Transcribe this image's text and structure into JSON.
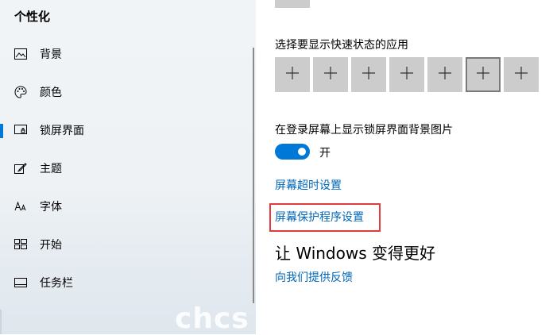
{
  "sidebar": {
    "title": "个性化",
    "items": [
      {
        "label": "背景",
        "icon": "image-icon"
      },
      {
        "label": "颜色",
        "icon": "palette-icon"
      },
      {
        "label": "锁屏界面",
        "icon": "lock-screen-icon",
        "active": true
      },
      {
        "label": "主题",
        "icon": "theme-brush-icon"
      },
      {
        "label": "字体",
        "icon": "font-icon"
      },
      {
        "label": "开始",
        "icon": "start-grid-icon"
      },
      {
        "label": "任务栏",
        "icon": "taskbar-icon"
      }
    ],
    "watermark": "chcs"
  },
  "main": {
    "quick_status_label": "选择要显示快速状态的应用",
    "quick_status_tiles": [
      "+",
      "+",
      "+",
      "+",
      "+",
      "+",
      "+"
    ],
    "show_background_label": "在登录屏幕上显示锁屏界面背景图片",
    "toggle_state": "开",
    "screen_timeout_link": "屏幕超时设置",
    "screensaver_link": "屏幕保护程序设置",
    "improve_heading": "让 Windows 变得更好",
    "feedback_link": "向我们提供反馈"
  },
  "colors": {
    "accent": "#0078d7",
    "link": "#0067b8",
    "highlight": "#e23b3b"
  }
}
